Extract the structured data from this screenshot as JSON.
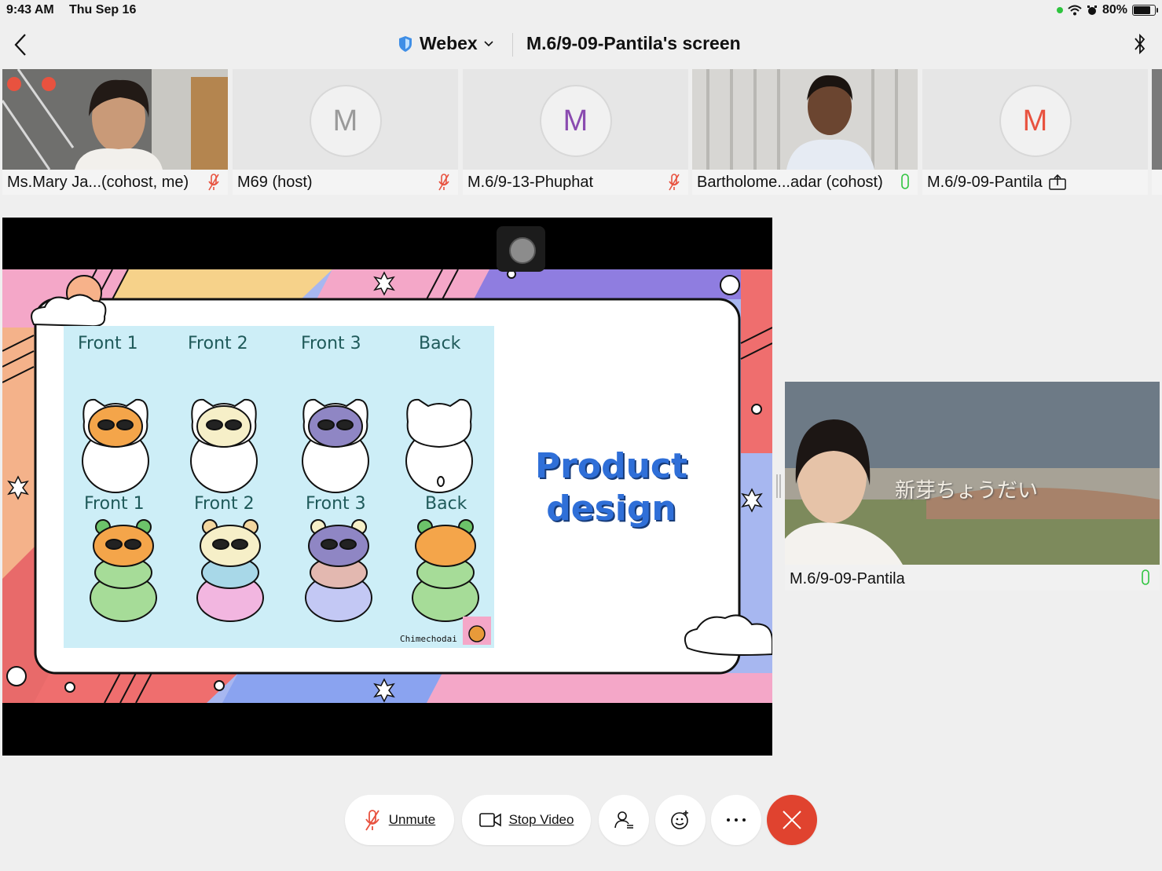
{
  "status": {
    "time": "9:43 AM",
    "date": "Thu Sep 16",
    "battery": "80%",
    "battery_level": 0.8
  },
  "header": {
    "app": "Webex",
    "title": "M.6/9-09-Pantila's screen"
  },
  "participants": [
    {
      "name": "Ms.Mary Ja...(cohost, me)",
      "initial": "",
      "mic": "muted"
    },
    {
      "name": "M69 (host)",
      "initial": "M",
      "mic": "muted",
      "color": "#9a9a9a"
    },
    {
      "name": "M.6/9-13-Phuphat",
      "initial": "M",
      "mic": "muted",
      "color": "#8a4bb0"
    },
    {
      "name": "Bartholome...adar (cohost)",
      "initial": "",
      "mic": "on"
    },
    {
      "name": "M.6/9-09-Pantila",
      "initial": "M",
      "mic": "sharing",
      "color": "#e8523f"
    }
  ],
  "slide": {
    "row1": [
      "Front 1",
      "Front 2",
      "Front 3",
      "Back"
    ],
    "row2": [
      "Front 1",
      "Front 2",
      "Front 3",
      "Back"
    ],
    "heading_line1": "Product",
    "heading_line2": "design",
    "credit": "Chimechodai"
  },
  "selfview": {
    "name": "M.6/9-09-Pantila",
    "caption": "新芽ちょうだい"
  },
  "controls": {
    "unmute": "Unmute",
    "stop_video": "Stop Video"
  },
  "colors": {
    "leave": "#e0432f",
    "accent_blue": "#2f6fd8",
    "mic_muted": "#e8523f",
    "mic_on": "#2ec43e"
  }
}
